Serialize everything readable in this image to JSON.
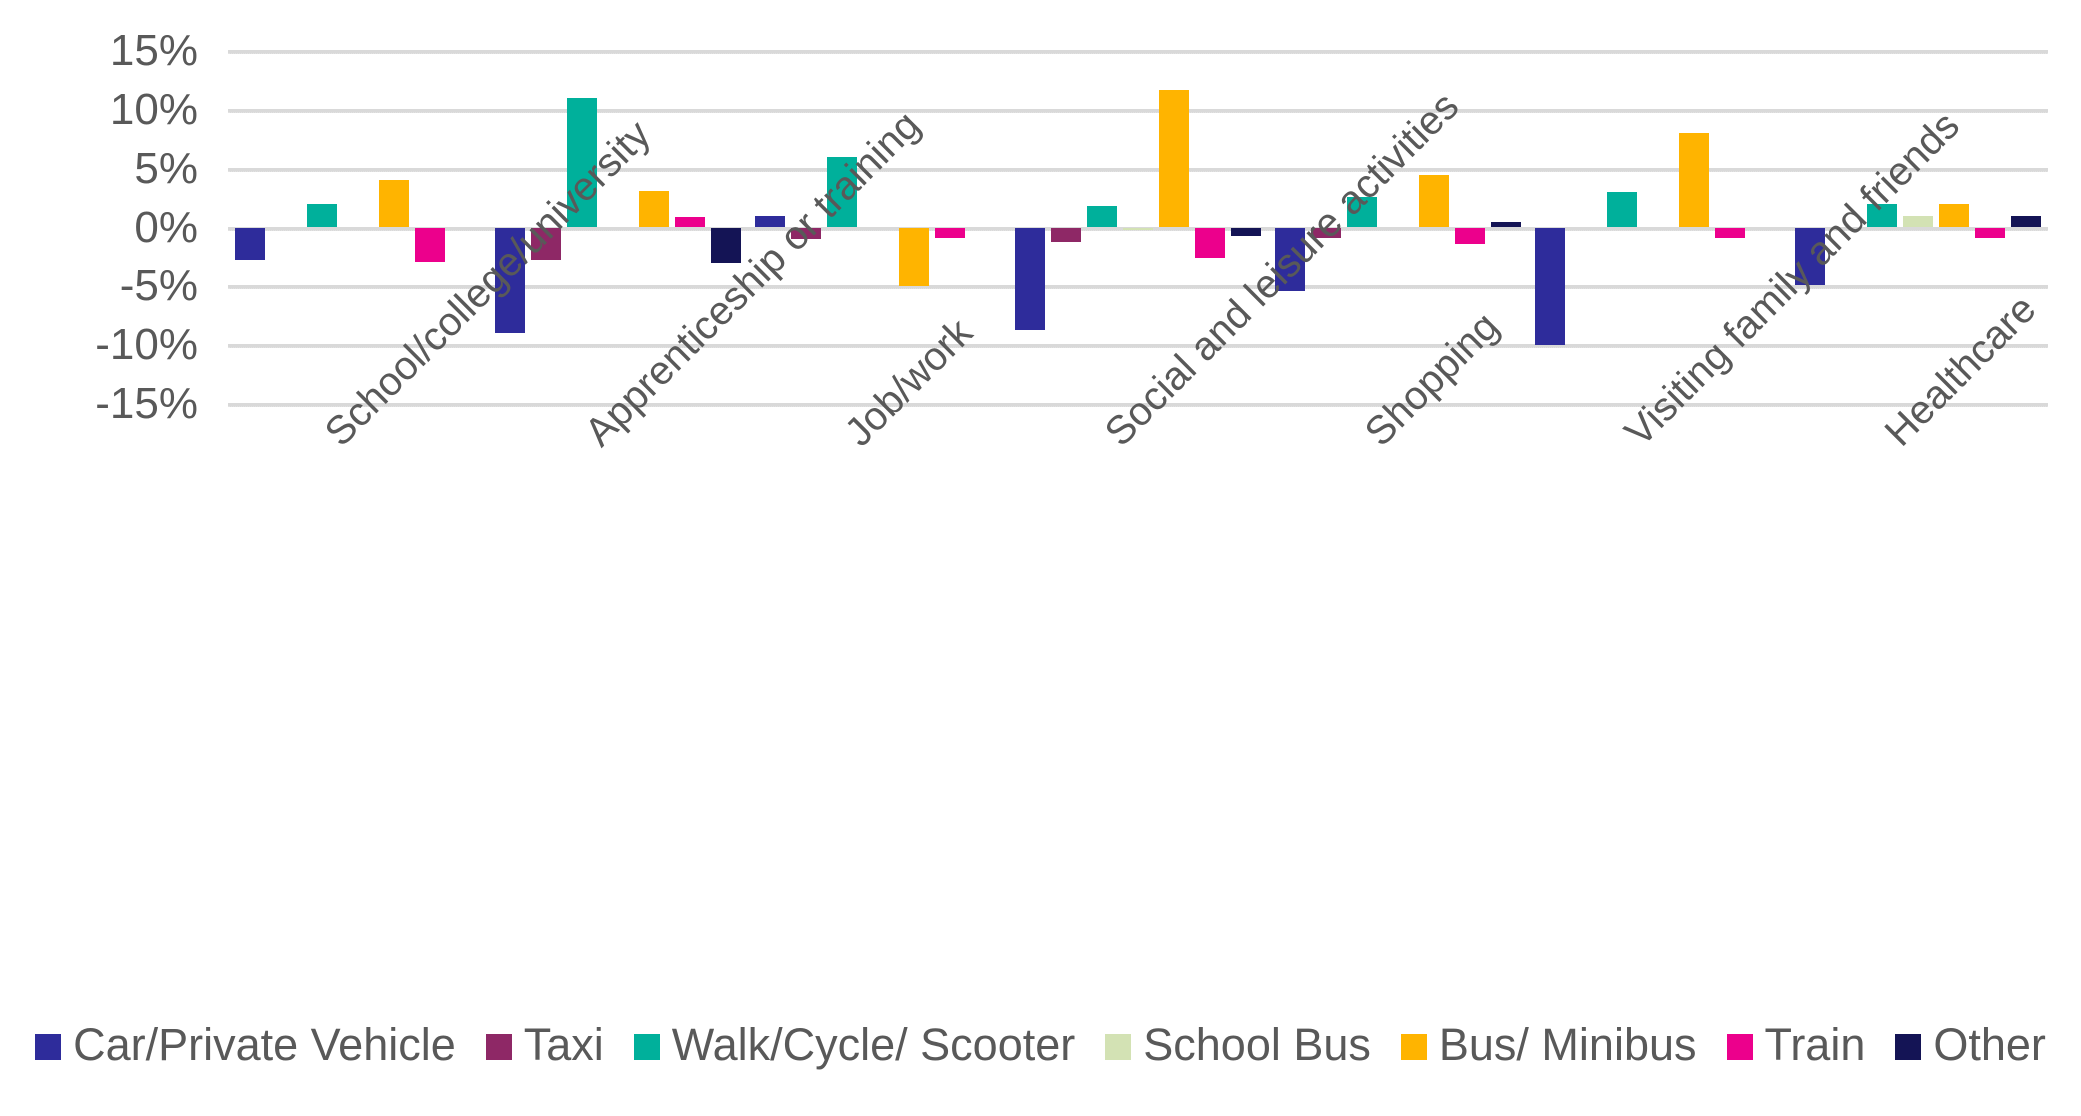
{
  "chart_data": {
    "type": "bar",
    "title": "",
    "subtitle": "",
    "xlabel": "",
    "ylabel": "",
    "ylim": [
      -15,
      15
    ],
    "ytick_labels": [
      "15%",
      "10%",
      "5%",
      "0%",
      "-5%",
      "-10%",
      "-15%"
    ],
    "ytick_values": [
      15,
      10,
      5,
      0,
      -5,
      -10,
      -15
    ],
    "ytick_format": "percent",
    "grid": true,
    "grid_axis": "y",
    "legend_position": "bottom",
    "orientation": "vertical",
    "categories": [
      "School/college/university",
      "Apprenticeship or training",
      "Job/work",
      "Social and leisure activities",
      "Shopping",
      "Visiting family and friends",
      "Healthcare"
    ],
    "series": [
      {
        "name": "Car/Private Vehicle",
        "color": "#2E2C9B",
        "values": [
          -2.8,
          -9.0,
          1.0,
          -8.7,
          -5.4,
          -10.0,
          -4.9
        ]
      },
      {
        "name": "Taxi",
        "color": "#8E2866",
        "values": [
          0.0,
          -2.8,
          -1.0,
          -1.2,
          -0.9,
          0.0,
          0.0
        ]
      },
      {
        "name": "Walk/Cycle/ Scooter",
        "color": "#00B09B",
        "values": [
          2.0,
          11.0,
          6.0,
          1.8,
          2.6,
          3.0,
          2.0
        ]
      },
      {
        "name": "School Bus",
        "color": "#D3E2B4",
        "values": [
          0.0,
          0.0,
          0.0,
          -0.2,
          0.0,
          0.0,
          1.0
        ]
      },
      {
        "name": "Bus/ Minibus",
        "color": "#FFB400",
        "values": [
          4.0,
          3.1,
          -5.0,
          11.7,
          4.5,
          8.0,
          2.0
        ]
      },
      {
        "name": "Train",
        "color": "#EC008C",
        "values": [
          -2.9,
          0.9,
          -0.9,
          -2.6,
          -1.4,
          -0.9,
          -0.9
        ]
      },
      {
        "name": "Other",
        "color": "#141455",
        "values": [
          0.0,
          -3.0,
          0.0,
          -0.7,
          0.5,
          0.0,
          1.0
        ]
      }
    ]
  },
  "legend": {
    "items": [
      {
        "label": "Car/Private Vehicle",
        "color": "#2E2C9B"
      },
      {
        "label": "Taxi",
        "color": "#8E2866"
      },
      {
        "label": "Walk/Cycle/ Scooter",
        "color": "#00B09B"
      },
      {
        "label": "School Bus",
        "color": "#D3E2B4"
      },
      {
        "label": "Bus/ Minibus",
        "color": "#FFB400"
      },
      {
        "label": "Train",
        "color": "#EC008C"
      },
      {
        "label": "Other",
        "color": "#141455"
      }
    ]
  },
  "axis": {
    "y_labels": [
      "15%",
      "10%",
      "5%",
      "0%",
      "-5%",
      "-10%",
      "-15%"
    ],
    "x_labels": [
      "School/college/university",
      "Apprenticeship or training",
      "Job/work",
      "Social and leisure activities",
      "Shopping",
      "Visiting family and friends",
      "Healthcare"
    ]
  },
  "style": {
    "gridline_color": "#D9D9D9",
    "text_color": "#595959",
    "background": "#FFFFFF"
  }
}
